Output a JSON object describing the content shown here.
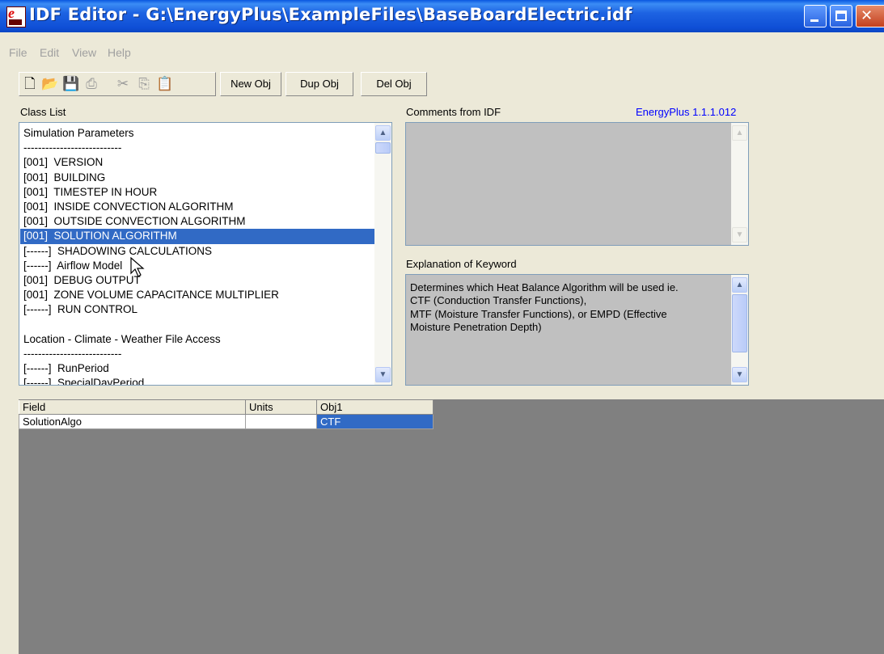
{
  "window": {
    "title": "IDF Editor - G:\\EnergyPlus\\ExampleFiles\\BaseBoardElectric.idf"
  },
  "menu": [
    "File",
    "Edit",
    "View",
    "Help"
  ],
  "toolbar": {
    "icons": [
      "new-file-icon",
      "open-folder-icon",
      "save-icon",
      "print-icon",
      "cut-icon",
      "copy-icon",
      "paste-icon"
    ],
    "new_obj": "New Obj",
    "dup_obj": "Dup Obj",
    "del_obj": "Del Obj"
  },
  "class_list": {
    "label": "Class List",
    "items": [
      "Simulation Parameters",
      "---------------------------",
      "[001]  VERSION",
      "[001]  BUILDING",
      "[001]  TIMESTEP IN HOUR",
      "[001]  INSIDE CONVECTION ALGORITHM",
      "[001]  OUTSIDE CONVECTION ALGORITHM",
      "[001]  SOLUTION ALGORITHM",
      "[------]  SHADOWING CALCULATIONS",
      "[------]  Airflow Model",
      "[001]  DEBUG OUTPUT",
      "[001]  ZONE VOLUME CAPACITANCE MULTIPLIER",
      "[------]  RUN CONTROL",
      "",
      "Location - Climate - Weather File Access",
      "---------------------------",
      "[------]  RunPeriod",
      "[------]  SpecialDayPeriod"
    ],
    "selected_index": 7
  },
  "comments": {
    "label": "Comments from IDF",
    "version": "EnergyPlus 1.1.1.012"
  },
  "explanation": {
    "label": "Explanation of Keyword",
    "lines": [
      "Determines which Heat Balance Algorithm will be used ie.",
      "CTF (Conduction Transfer Functions),",
      "MTF (Moisture Transfer Functions), or EMPD (Effective",
      "Moisture Penetration Depth)"
    ]
  },
  "grid": {
    "headers": [
      "Field",
      "Units",
      "Obj1"
    ],
    "rows": [
      [
        "SolutionAlgo",
        "",
        "CTF"
      ]
    ]
  },
  "colors": {
    "selection": "#316ac5",
    "version_text": "#0000ff",
    "title_bar": "#0f4fd6"
  }
}
